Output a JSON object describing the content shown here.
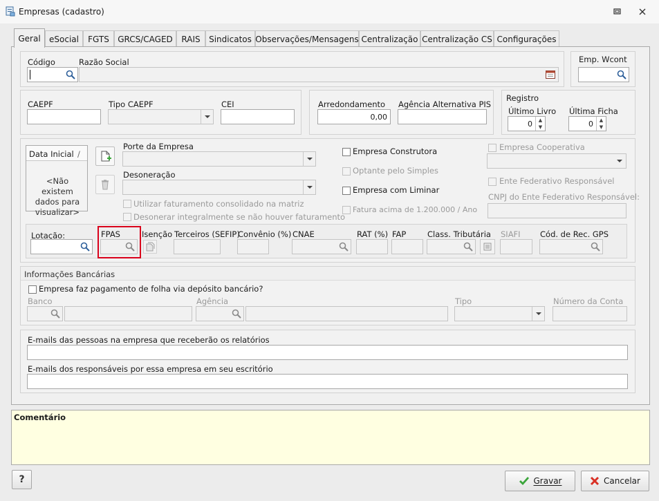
{
  "window": {
    "title": "Empresas (cadastro)"
  },
  "tabs": [
    "Geral",
    "eSocial",
    "FGTS",
    "GRCS/CAGED",
    "RAIS",
    "Sindicatos",
    "Observações/Mensagens",
    "Centralização",
    "Centralização CS",
    "Configurações"
  ],
  "identificacao": {
    "codigo_label": "Código",
    "razao_social_label": "Razão Social",
    "emp_wcont_label": "Emp. Wcont"
  },
  "caepf": {
    "caepf_label": "CAEPF",
    "tipo_caepf_label": "Tipo CAEPF",
    "cei_label": "CEI"
  },
  "arredondamento": {
    "label": "Arredondamento",
    "value": "0,00",
    "agencia_label": "Agência Alternativa PIS"
  },
  "registro": {
    "title": "Registro",
    "ultimo_livro_label": "Último Livro",
    "ultimo_livro_value": "0",
    "ultima_ficha_label": "Última Ficha",
    "ultima_ficha_value": "0"
  },
  "data_inicial": {
    "header": "Data Inicial",
    "sort_glyph": "/",
    "empty_text": "<Não existem dados para visualizar>"
  },
  "porte": {
    "porte_label": "Porte da Empresa",
    "desoneracao_label": "Desoneração",
    "utilizar_fat_label": "Utilizar faturamento consolidado na matriz",
    "desonerar_label": "Desonerar integralmente se não houver faturamento"
  },
  "flags": {
    "construtora": "Empresa Construtora",
    "optante": "Optante pelo Simples",
    "liminar": "Empresa com Liminar",
    "fatura": "Fatura acima de 1.200.000 / Ano",
    "cooperativa": "Empresa Cooperativa",
    "ente_fed": "Ente Federativo Responsável",
    "cnpj_ente": "CNPJ do Ente Federativo Responsável:"
  },
  "lotacao": {
    "lotacao_label": "Lotação:",
    "fpas_label": "FPAS",
    "isencao_label": "Isenção",
    "terceiros_label": "Terceiros (SEFIP)",
    "convenio_label": "Convênio (%)",
    "cnae_label": "CNAE",
    "rat_label": "RAT (%)",
    "fap_label": "FAP",
    "class_trib_label": "Class. Tributária",
    "siafi_label": "SIAFI",
    "cod_gps_label": "Cód. de Rec. GPS"
  },
  "bancarias": {
    "title": "Informações Bancárias",
    "deposito_label": "Empresa faz pagamento de folha via depósito bancário?",
    "banco_label": "Banco",
    "agencia_label": "Agência",
    "tipo_label": "Tipo",
    "numero_conta_label": "Número da Conta"
  },
  "emails": {
    "relatorios_label": "E-mails das pessoas na empresa que receberão os relatórios",
    "responsaveis_label": "E-mails dos responsáveis por essa empresa em seu escritório"
  },
  "comentario": {
    "label": "Comentário"
  },
  "footer": {
    "help_label": "?",
    "gravar_label": "Gravar",
    "cancelar_label": "Cancelar"
  },
  "colors": {
    "highlight_border": "#d9001b",
    "comentario_bg": "#ffffe1",
    "save_icon": "#3aa53a",
    "cancel_icon": "#d93025"
  }
}
